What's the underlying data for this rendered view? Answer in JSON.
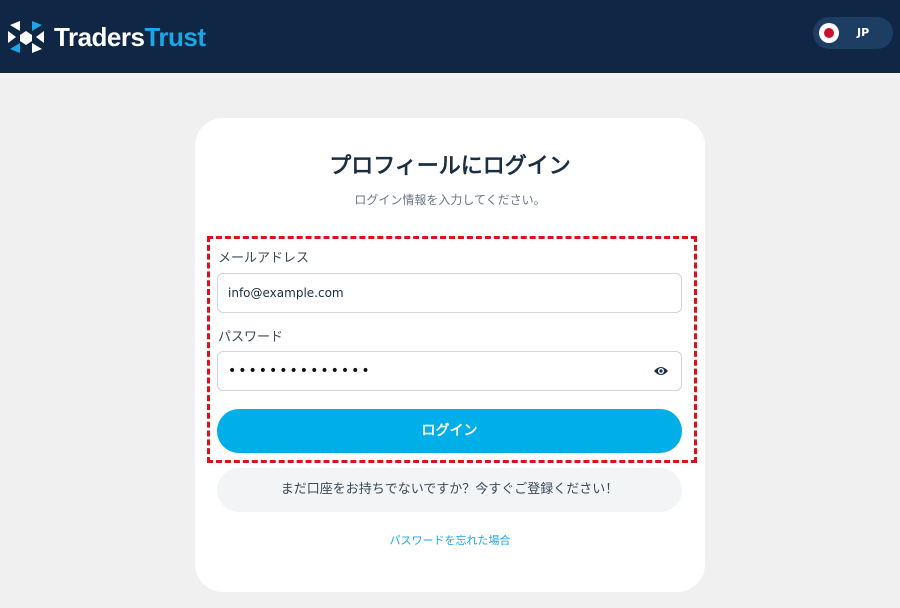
{
  "header": {
    "logo_text_white": "Traders",
    "logo_text_blue": "Trust",
    "language": "JP"
  },
  "login": {
    "title": "プロフィールにログイン",
    "subtitle": "ログイン情報を入力してください。",
    "email_label": "メールアドレス",
    "email_value": "info@example.com",
    "password_label": "パスワード",
    "password_value": "••••••••••••••",
    "login_button": "ログイン",
    "signup_text": "まだ口座をお持ちでないですか？今すぐご登録ください！",
    "forgot_link": "パスワードを忘れた場合"
  },
  "colors": {
    "header_bg": "#0f2744",
    "accent": "#00aee8",
    "highlight": "#e0101a"
  },
  "icons": [
    "traders-trust-logo-icon",
    "japan-flag-icon",
    "eye-icon"
  ]
}
